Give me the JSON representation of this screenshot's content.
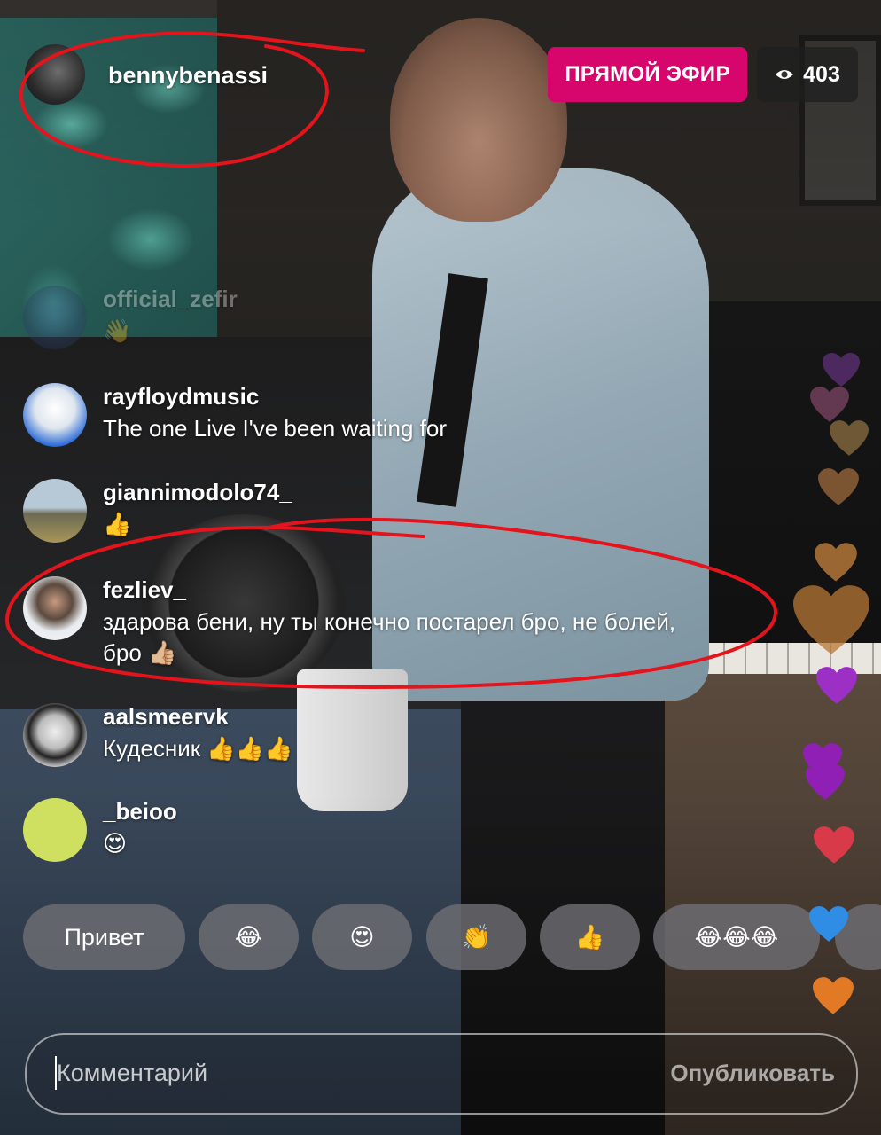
{
  "stream": {
    "host_name": "bennybenassi",
    "live_label": "ПРЯМОЙ ЭФИР",
    "viewer_count": "403"
  },
  "comments": [
    {
      "user": "official_zefir",
      "text": "👋",
      "faded": true
    },
    {
      "user": "rayfloydmusic",
      "text": "The one Live I've been waiting for"
    },
    {
      "user": "giannimodolo74_",
      "text": "👍"
    },
    {
      "user": "fezliev_",
      "text": "здарова бени, ну ты конечно постарел бро, не болей, бро 👍🏼"
    },
    {
      "user": "aalsmeervk",
      "text": "Кудесник 👍👍👍"
    },
    {
      "user": "_beioo",
      "text": "😍"
    }
  ],
  "quick_reactions": [
    "Привет",
    "😂",
    "😍",
    "👏",
    "👍",
    "😂😂😂"
  ],
  "comment_input": {
    "placeholder": "Комментарий",
    "post_label": "Опубликовать"
  },
  "colors": {
    "live_badge": "#d6066d",
    "annotation_red": "#e3141c",
    "hearts": [
      "#7a3a9a",
      "#b25b8e",
      "#b89050",
      "#c28047",
      "#c8843e",
      "#b87735",
      "#9c2fc4",
      "#8f1fb5",
      "#d83a4a",
      "#2f8de6",
      "#e27a25"
    ]
  }
}
